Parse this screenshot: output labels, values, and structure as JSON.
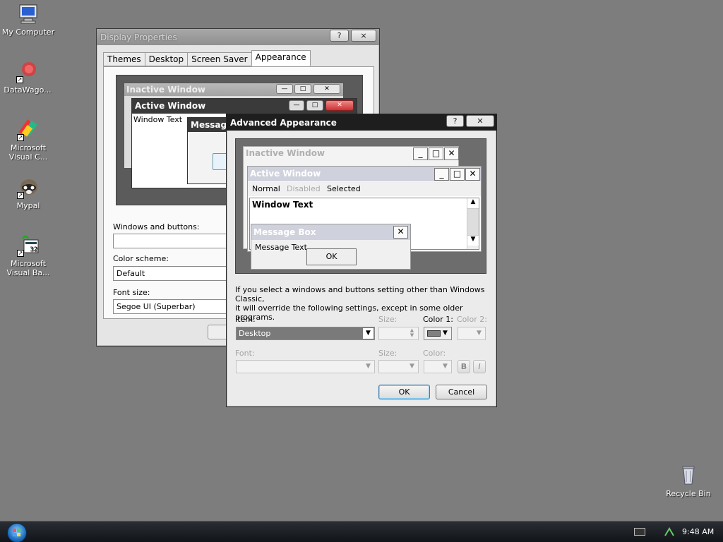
{
  "desktop": {
    "icons": [
      {
        "label": "My Computer",
        "icon": "computer-icon"
      },
      {
        "label": "DataWago...",
        "icon": "datawagon-icon"
      },
      {
        "label": "Microsoft Visual C...",
        "icon": "visual-c-icon"
      },
      {
        "label": "Mypal",
        "icon": "mypal-icon"
      },
      {
        "label": "Microsoft Visual Ba...",
        "icon": "visual-basic-icon"
      },
      {
        "label": "Recycle Bin",
        "icon": "recycle-bin-icon"
      }
    ]
  },
  "display_properties": {
    "title": "Display Properties",
    "help_glyph": "?",
    "close_glyph": "⨯",
    "tabs": [
      "Themes",
      "Desktop",
      "Screen Saver",
      "Appearance"
    ],
    "active_tab": "Appearance",
    "preview": {
      "inactive_title": "Inactive Window",
      "active_title": "Active Window",
      "window_text": "Window Text",
      "message_title": "Message"
    },
    "windows_buttons_label": "Windows and buttons:",
    "windows_buttons_value": "",
    "color_scheme_label": "Color scheme:",
    "color_scheme_value": "Default",
    "font_size_label": "Font size:",
    "font_size_value": "Segoe UI (Superbar)"
  },
  "advanced_appearance": {
    "title": "Advanced Appearance",
    "help_glyph": "?",
    "close_glyph": "✕",
    "preview": {
      "inactive_title": "Inactive Window",
      "active_title": "Active Window",
      "menu_normal": "Normal",
      "menu_disabled": "Disabled",
      "menu_selected": "Selected",
      "window_text": "Window Text",
      "message_box_title": "Message Box",
      "message_text": "Message Text",
      "ok_label": "OK"
    },
    "info_text_line1": "If you select a windows and buttons setting other than Windows Classic,",
    "info_text_line2": "it will override the following settings, except in some older programs.",
    "item_label": "Item:",
    "item_value": "Desktop",
    "size_label": "Size:",
    "color1_label": "Color 1:",
    "color1_value": "#808080",
    "color2_label": "Color 2:",
    "font_label": "Font:",
    "font_size_label": "Size:",
    "font_color_label": "Color:",
    "bold_label": "B",
    "italic_label": "I",
    "ok_label": "OK",
    "cancel_label": "Cancel"
  },
  "taskbar": {
    "clock": "9:48 AM"
  }
}
